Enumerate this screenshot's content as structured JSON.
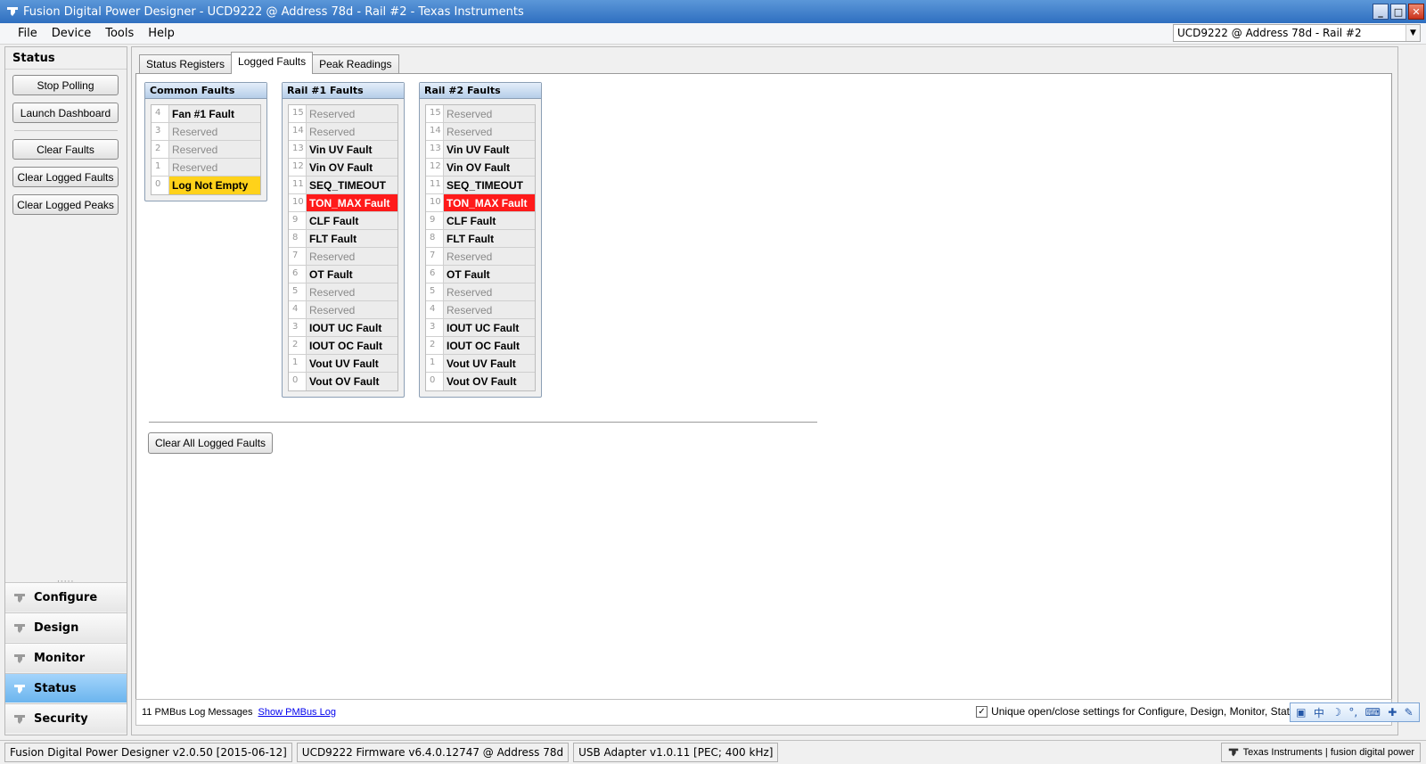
{
  "window": {
    "title": "Fusion Digital Power Designer - UCD9222 @ Address 78d - Rail #2 - Texas Instruments",
    "buttons": {
      "minimize": "_",
      "maximize": "□",
      "close": "✕"
    }
  },
  "menu": {
    "items": [
      "File",
      "Device",
      "Tools",
      "Help"
    ],
    "device_select": "UCD9222 @ Address 78d - Rail #2"
  },
  "sidebar": {
    "title": "Status",
    "buttons": [
      "Stop Polling",
      "Launch Dashboard",
      "Clear Faults",
      "Clear Logged Faults",
      "Clear Logged Peaks"
    ],
    "nav": [
      "Configure",
      "Design",
      "Monitor",
      "Status",
      "Security"
    ],
    "active_nav": "Status"
  },
  "tabs": {
    "items": [
      "Status Registers",
      "Logged Faults",
      "Peak Readings"
    ],
    "active": "Logged Faults"
  },
  "fault_groups": [
    {
      "title": "Common Faults",
      "rows": [
        {
          "bit": "4",
          "label": "Fan #1 Fault",
          "state": "normal"
        },
        {
          "bit": "3",
          "label": "Reserved",
          "state": "reserved"
        },
        {
          "bit": "2",
          "label": "Reserved",
          "state": "reserved"
        },
        {
          "bit": "1",
          "label": "Reserved",
          "state": "reserved"
        },
        {
          "bit": "0",
          "label": "Log Not Empty",
          "state": "warning"
        }
      ]
    },
    {
      "title": "Rail #1 Faults",
      "rows": [
        {
          "bit": "15",
          "label": "Reserved",
          "state": "reserved"
        },
        {
          "bit": "14",
          "label": "Reserved",
          "state": "reserved"
        },
        {
          "bit": "13",
          "label": "Vin UV Fault",
          "state": "normal"
        },
        {
          "bit": "12",
          "label": "Vin OV Fault",
          "state": "normal"
        },
        {
          "bit": "11",
          "label": "SEQ_TIMEOUT",
          "state": "normal"
        },
        {
          "bit": "10",
          "label": "TON_MAX Fault",
          "state": "fault"
        },
        {
          "bit": "9",
          "label": "CLF Fault",
          "state": "normal"
        },
        {
          "bit": "8",
          "label": "FLT Fault",
          "state": "normal"
        },
        {
          "bit": "7",
          "label": "Reserved",
          "state": "reserved"
        },
        {
          "bit": "6",
          "label": "OT Fault",
          "state": "normal"
        },
        {
          "bit": "5",
          "label": "Reserved",
          "state": "reserved"
        },
        {
          "bit": "4",
          "label": "Reserved",
          "state": "reserved"
        },
        {
          "bit": "3",
          "label": "IOUT UC Fault",
          "state": "normal"
        },
        {
          "bit": "2",
          "label": "IOUT OC Fault",
          "state": "normal"
        },
        {
          "bit": "1",
          "label": "Vout UV Fault",
          "state": "normal"
        },
        {
          "bit": "0",
          "label": "Vout OV Fault",
          "state": "normal"
        }
      ]
    },
    {
      "title": "Rail #2 Faults",
      "rows": [
        {
          "bit": "15",
          "label": "Reserved",
          "state": "reserved"
        },
        {
          "bit": "14",
          "label": "Reserved",
          "state": "reserved"
        },
        {
          "bit": "13",
          "label": "Vin UV Fault",
          "state": "normal"
        },
        {
          "bit": "12",
          "label": "Vin OV Fault",
          "state": "normal"
        },
        {
          "bit": "11",
          "label": "SEQ_TIMEOUT",
          "state": "normal"
        },
        {
          "bit": "10",
          "label": "TON_MAX Fault",
          "state": "fault"
        },
        {
          "bit": "9",
          "label": "CLF Fault",
          "state": "normal"
        },
        {
          "bit": "8",
          "label": "FLT Fault",
          "state": "normal"
        },
        {
          "bit": "7",
          "label": "Reserved",
          "state": "reserved"
        },
        {
          "bit": "6",
          "label": "OT Fault",
          "state": "normal"
        },
        {
          "bit": "5",
          "label": "Reserved",
          "state": "reserved"
        },
        {
          "bit": "4",
          "label": "Reserved",
          "state": "reserved"
        },
        {
          "bit": "3",
          "label": "IOUT UC Fault",
          "state": "normal"
        },
        {
          "bit": "2",
          "label": "IOUT OC Fault",
          "state": "normal"
        },
        {
          "bit": "1",
          "label": "Vout UV Fault",
          "state": "normal"
        },
        {
          "bit": "0",
          "label": "Vout OV Fault",
          "state": "normal"
        }
      ]
    }
  ],
  "clear_all_button": "Clear All Logged Faults",
  "log": {
    "count_text": "11 PMBus Log Messages",
    "link": "Show PMBus Log",
    "unique_setting": "Unique open/close settings for Configure, Design, Monitor, Status, and Security",
    "unique_checked": "✓"
  },
  "ime": [
    "中",
    "☽",
    "°,",
    "⌨",
    "✚",
    "✎"
  ],
  "statusbar": {
    "app": "Fusion Digital Power Designer v2.0.50 [2015-06-12]",
    "firmware": "UCD9222 Firmware v6.4.0.12747 @ Address 78d",
    "adapter": "USB Adapter v1.0.11 [PEC; 400 kHz]",
    "brand": "Texas Instruments | fusion digital power"
  },
  "colors": {
    "fault": "#ff1a1a",
    "warning": "#ffd21a",
    "active_nav": "#6bb5ee"
  },
  "icons": {
    "window": "ti-logo-icon",
    "nav": "ti-state-icon",
    "dropdown": "chevron-down-icon"
  }
}
